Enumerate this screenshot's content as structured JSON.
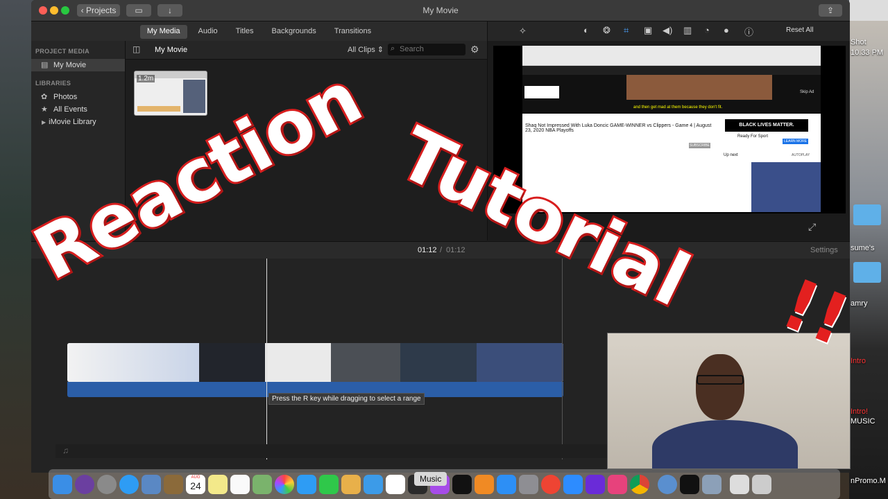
{
  "window": {
    "title": "My Movie",
    "projects_label": "Projects",
    "share_icon": "share-icon"
  },
  "browser_tabs": [
    "My Media",
    "Audio",
    "Titles",
    "Backgrounds",
    "Transitions"
  ],
  "sidebar": {
    "project_media_heading": "PROJECT MEDIA",
    "project_item": "My Movie",
    "libraries_heading": "LIBRARIES",
    "items": [
      "Photos",
      "All Events",
      "iMovie Library"
    ]
  },
  "browser": {
    "current": "My Movie",
    "filter": "All Clips",
    "search_placeholder": "Search",
    "clip_duration": "1.2m"
  },
  "viewer": {
    "reset_all": "Reset All",
    "preview": {
      "caption": "and then get mad at them because they don't fit.",
      "video_title": "Shaq Not Impressed With Luka Doncic GAME-WINNER vs Clippers - Game 4 | August 23, 2020 NBA Playoffs",
      "ad_banner": "BLACK LIVES MATTER.",
      "sponsor": "Ready For Sport",
      "learn_more": "LEARN MORE",
      "skip_ad": "Skip Ad",
      "up_next": "Up next",
      "autoplay": "AUTOPLAY",
      "subscribe": "SUBSCRIBE"
    }
  },
  "timeline": {
    "time_current": "01:12",
    "time_separator": "/",
    "time_total": "01:12",
    "settings": "Settings",
    "tooltip": "Press the R key while dragging to select a range"
  },
  "overlay": {
    "title_line1": "Reaction",
    "title_line2": "Tutorial",
    "exclaim": "!!"
  },
  "dock": {
    "tooltip": "Music",
    "calendar_day": "24",
    "calendar_month": "AUG"
  },
  "desktop": {
    "labels": [
      "Shot",
      "10.33 PM",
      "sume's",
      "amry",
      "Intro",
      "Intro!",
      "MUSIC",
      "nPromo.M"
    ]
  },
  "colors": {
    "accent_red": "#d81e1e",
    "clip_blue": "#2b5ea8"
  }
}
